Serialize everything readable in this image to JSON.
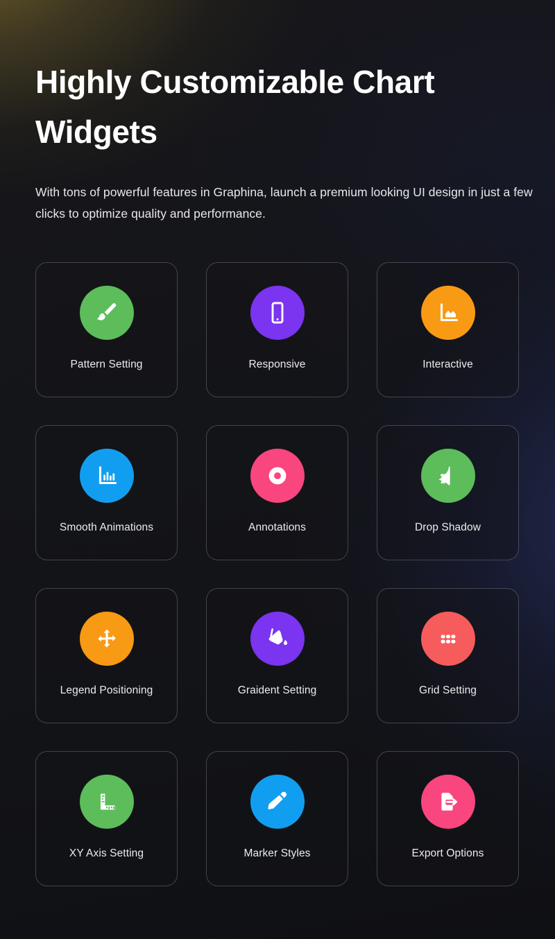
{
  "header": {
    "title": "Highly Customizable Chart Widgets",
    "subtitle": "With tons of powerful features in Graphina, launch a premium looking UI design in just a few clicks to optimize quality and performance."
  },
  "colors": {
    "green": "#5cbd5a",
    "purple": "#7b34f0",
    "orange": "#f99a15",
    "blue": "#129ef0",
    "pink": "#f9467f",
    "red": "#f65c5c",
    "page_background": "#111216",
    "card_border": "rgba(214,214,222,0.26)",
    "text": "#ffffff"
  },
  "features": [
    {
      "label": "Pattern Setting",
      "icon": "paintbrush-icon",
      "color": "#5cbd5a"
    },
    {
      "label": "Responsive",
      "icon": "mobile-phone-icon",
      "color": "#7b34f0"
    },
    {
      "label": "Interactive",
      "icon": "area-chart-icon",
      "color": "#f99a15"
    },
    {
      "label": "Smooth Animations",
      "icon": "bar-chart-icon",
      "color": "#129ef0"
    },
    {
      "label": "Annotations",
      "icon": "donut-icon",
      "color": "#f9467f"
    },
    {
      "label": "Drop Shadow",
      "icon": "half-star-icon",
      "color": "#5cbd5a"
    },
    {
      "label": "Legend Positioning",
      "icon": "move-arrows-icon",
      "color": "#f99a15"
    },
    {
      "label": "Graident Setting",
      "icon": "paint-bucket-icon",
      "color": "#7b34f0"
    },
    {
      "label": "Grid Setting",
      "icon": "grid-dots-icon",
      "color": "#f65c5c"
    },
    {
      "label": "XY Axis Setting",
      "icon": "ruler-icon",
      "color": "#5cbd5a"
    },
    {
      "label": "Marker Styles",
      "icon": "pen-icon",
      "color": "#129ef0"
    },
    {
      "label": "Export Options",
      "icon": "file-export-icon",
      "color": "#f9467f"
    }
  ]
}
